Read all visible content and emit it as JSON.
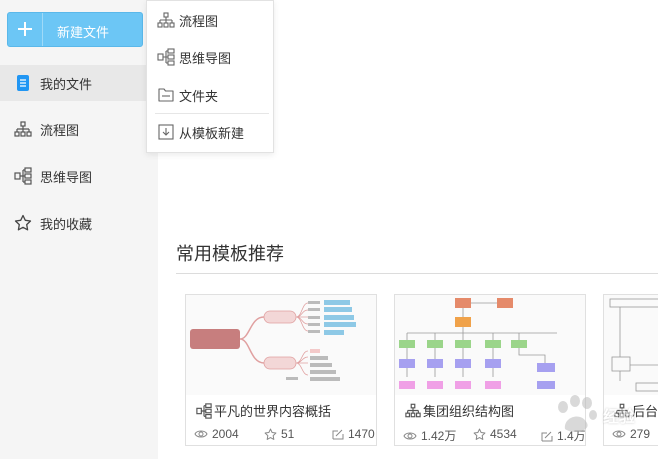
{
  "sidebar": {
    "new_button": {
      "label": "新建文件",
      "icon": "plus-icon"
    },
    "items": [
      {
        "label": "我的文件",
        "icon": "document-icon",
        "active": true
      },
      {
        "label": "流程图",
        "icon": "flowchart-icon",
        "active": false
      },
      {
        "label": "思维导图",
        "icon": "mindmap-icon",
        "active": false
      },
      {
        "label": "我的收藏",
        "icon": "star-icon",
        "active": false
      }
    ]
  },
  "dropdown": {
    "items": [
      {
        "label": "流程图",
        "icon": "flowchart-icon"
      },
      {
        "label": "思维导图",
        "icon": "mindmap-icon"
      },
      {
        "label": "文件夹",
        "icon": "folder-icon"
      },
      {
        "label": "从模板新建",
        "icon": "template-icon"
      }
    ]
  },
  "main": {
    "section_title": "常用模板推荐",
    "cards": [
      {
        "title": "平凡的世界内容概括",
        "type_icon": "mindmap-icon",
        "views": "2004",
        "stars": "51",
        "edits": "1470"
      },
      {
        "title": "集团组织结构图",
        "type_icon": "flowchart-icon",
        "views": "1.42万",
        "stars": "4534",
        "edits": "1.4万"
      },
      {
        "title": "后台",
        "type_icon": "flowchart-icon",
        "views": "279",
        "stars": "",
        "edits": ""
      }
    ]
  },
  "watermark": {
    "text": "经验",
    "brand": "Baidu"
  },
  "colors": {
    "accent": "#6cc6f5",
    "active_nav_icon": "#2196f3",
    "sidebar_bg": "#f5f5f5"
  }
}
